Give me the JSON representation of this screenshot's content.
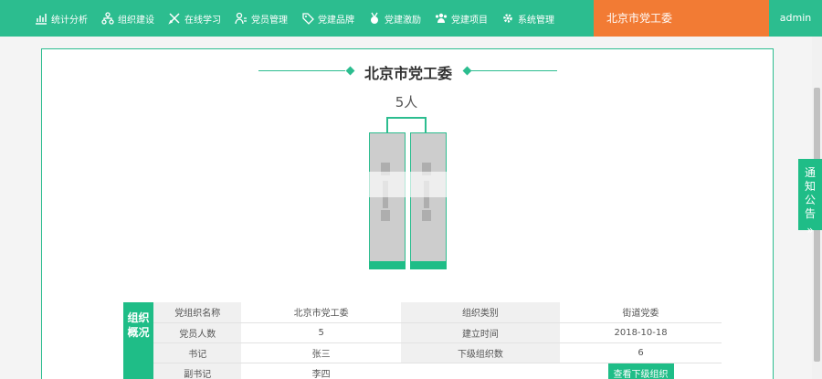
{
  "nav": {
    "items": [
      {
        "label": "统计分析",
        "icon": "chart-icon"
      },
      {
        "label": "组织建设",
        "icon": "org-tree-icon"
      },
      {
        "label": "在线学习",
        "icon": "pencil-icon"
      },
      {
        "label": "党员管理",
        "icon": "member-icon"
      },
      {
        "label": "党建品牌",
        "icon": "tag-icon"
      },
      {
        "label": "党建激励",
        "icon": "medal-icon"
      },
      {
        "label": "党建项目",
        "icon": "group-icon"
      },
      {
        "label": "系统管理",
        "icon": "gear-icon"
      }
    ],
    "org": "北京市党工委",
    "user": "admin"
  },
  "main": {
    "title": "北京市党工委",
    "count": "5人"
  },
  "info": {
    "section": "组织概况",
    "rows": [
      [
        "党组织名称",
        "北京市党工委",
        "组织类别",
        "街道党委"
      ],
      [
        "党员人数",
        "5",
        "建立时间",
        "2018-10-18"
      ],
      [
        "书记",
        "张三",
        "下级组织数",
        "6"
      ],
      [
        "副书记",
        "李四",
        "",
        "查看下级组织"
      ]
    ]
  },
  "notice": {
    "label": "通知公告",
    "chevron": "»"
  },
  "colors": {
    "primary": "#2cbd8f",
    "accent": "#f27b34"
  }
}
